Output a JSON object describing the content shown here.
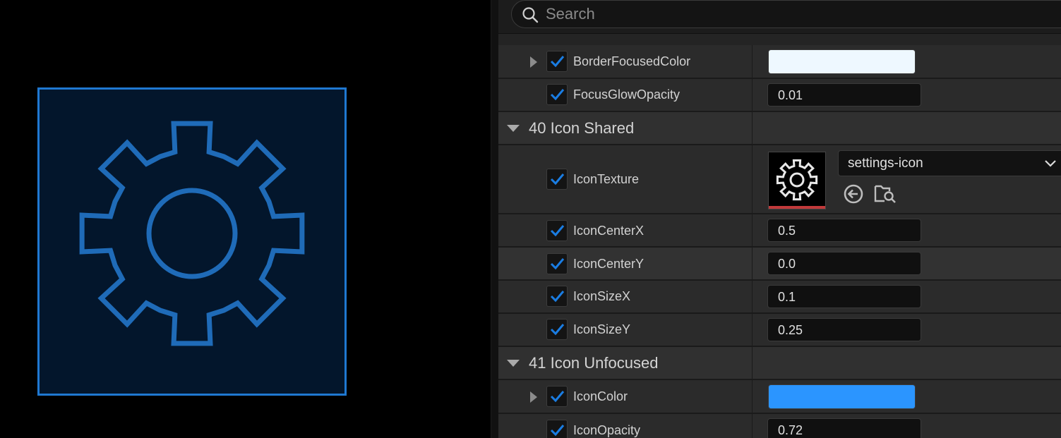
{
  "search": {
    "placeholder": "Search"
  },
  "colors": {
    "preview_bg": "#03162c",
    "preview_border": "#1f78d1",
    "gear_stroke": "#1f6bb8",
    "border_focused_color": "#eef8ff",
    "icon_color": "#2b95ff",
    "checkbox_check": "#1a7de3",
    "texture_underline": "#c1393a"
  },
  "preview": {
    "icon": "settings-icon"
  },
  "properties": {
    "border_focused_color": {
      "label": "BorderFocusedColor"
    },
    "focus_glow_opacity": {
      "label": "FocusGlowOpacity",
      "value": "0.01"
    },
    "cat40": {
      "label": "40 Icon Shared"
    },
    "icon_texture": {
      "label": "IconTexture",
      "asset": "settings-icon"
    },
    "icon_center_x": {
      "label": "IconCenterX",
      "value": "0.5"
    },
    "icon_center_y": {
      "label": "IconCenterY",
      "value": "0.0"
    },
    "icon_size_x": {
      "label": "IconSizeX",
      "value": "0.1"
    },
    "icon_size_y": {
      "label": "IconSizeY",
      "value": "0.25"
    },
    "cat41": {
      "label": "41 Icon Unfocused"
    },
    "icon_color": {
      "label": "IconColor"
    },
    "icon_opacity": {
      "label": "IconOpacity",
      "value": "0.72"
    }
  }
}
